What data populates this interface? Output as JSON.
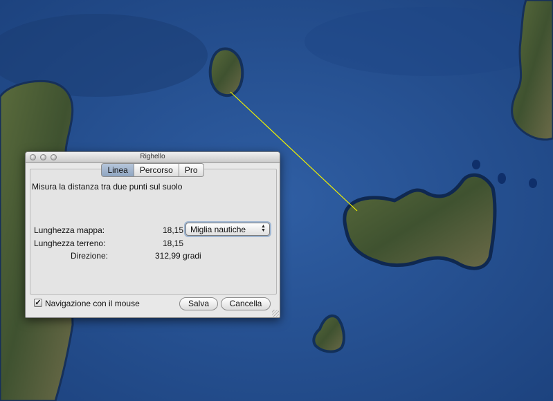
{
  "window": {
    "title": "Righello",
    "tabs": [
      {
        "label": "Linea",
        "active": true
      },
      {
        "label": "Percorso",
        "active": false
      },
      {
        "label": "Pro",
        "active": false
      }
    ],
    "description": "Misura la distanza tra due punti sul suolo",
    "map_length_label": "Lunghezza mappa:",
    "map_length_value": "18,15",
    "ground_length_label": "Lunghezza terreno:",
    "ground_length_value": "18,15",
    "heading_label": "Direzione:",
    "heading_value": "312,99 gradi",
    "unit_selected": "Miglia nautiche",
    "mouse_nav_label": "Navigazione con il mouse",
    "mouse_nav_checked": true,
    "save_label": "Salva",
    "cancel_label": "Cancella"
  },
  "colors": {
    "sea": "#234d8f",
    "land": "#4a5c34",
    "ruler_line": "#f0f000"
  }
}
